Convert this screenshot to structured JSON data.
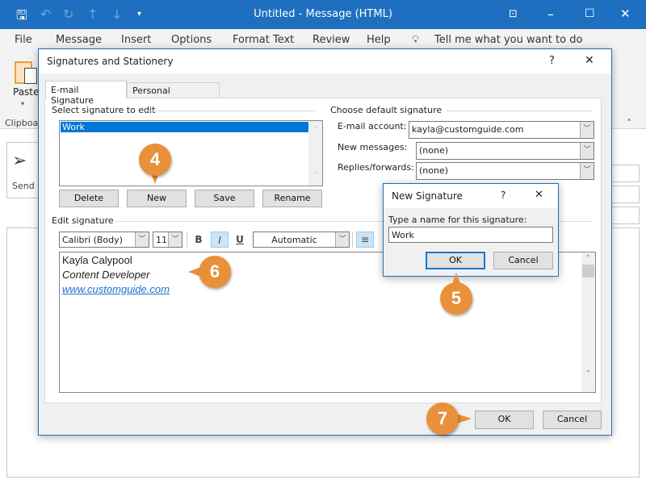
{
  "window": {
    "title": "Untitled  -  Message (HTML)"
  },
  "menu": [
    "File",
    "Message",
    "Insert",
    "Options",
    "Format Text",
    "Review",
    "Help"
  ],
  "tell_me": "Tell me what you want to do",
  "ribbon": {
    "paste": "Paste",
    "clipboard": "Clipboa",
    "send": "Send"
  },
  "dialog": {
    "title": "Signatures and Stationery",
    "help": "?",
    "close": "X",
    "tabs": [
      "E-mail Signature",
      "Personal Stationery"
    ],
    "select_label": "Select signature to edit",
    "signatures": [
      "Work"
    ],
    "buttons": {
      "delete": "Delete",
      "new": "New",
      "save": "Save",
      "rename": "Rename"
    },
    "default_label": "Choose default signature",
    "email_account_label": "E-mail account:",
    "email_account": "kayla@customguide.com",
    "new_messages_label": "New messages:",
    "new_messages": "(none)",
    "replies_label": "Replies/forwards:",
    "replies": "(none)",
    "edit_label": "Edit signature",
    "font": "Calibri (Body)",
    "size": "11",
    "bold": "B",
    "italic": "I",
    "underline": "U",
    "color": "Automatic",
    "signature": {
      "name": "Kayla Calypool",
      "role": "Content Developer",
      "link": "www.customguide.com"
    },
    "ok": "OK",
    "cancel": "Cancel"
  },
  "new_sig": {
    "title": "New Signature",
    "help": "?",
    "close": "X",
    "prompt": "Type a name for this signature:",
    "value": "Work",
    "ok": "OK",
    "cancel": "Cancel"
  },
  "callouts": [
    "4",
    "5",
    "6",
    "7"
  ],
  "colors": {
    "titlebar": "#1e6fbf",
    "callout": "#e8903a",
    "selection": "#0078d7"
  }
}
